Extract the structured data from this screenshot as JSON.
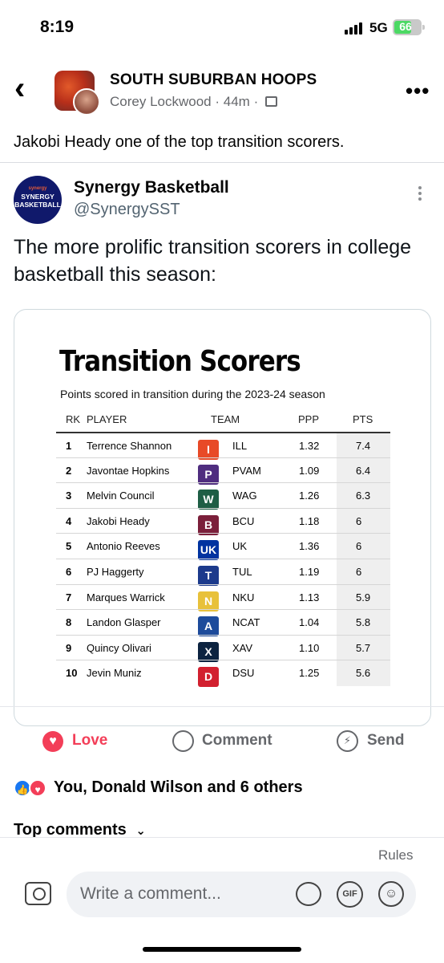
{
  "status_bar": {
    "time": "8:19",
    "network": "5G",
    "battery": "66",
    "battery_level": 0.66
  },
  "post": {
    "group_name": "SOUTH SUBURBAN HOOPS",
    "author": "Corey Lockwood",
    "separator": "·",
    "time_ago": "44m",
    "text": "Jakobi Heady one of the top transition scorers."
  },
  "tweet": {
    "avatar_small": "synergy",
    "avatar_big": "SYNERGY BASKETBALL",
    "name": "Synergy Basketball",
    "handle": "@SynergySST",
    "text": "The more prolific transition scorers in college basketball this season:"
  },
  "table": {
    "title": "Transition Scorers",
    "subtitle": "Points scored in transition during the 2023-24 season",
    "headers": {
      "rk": "RK",
      "player": "PLAYER",
      "team": "TEAM",
      "ppp": "PPP",
      "pts": "PTS"
    },
    "rows": [
      {
        "rk": "1",
        "player": "Terrence Shannon",
        "team": "ILL",
        "ppp": "1.32",
        "pts": "7.4",
        "logo": "I",
        "color": "#e84a27"
      },
      {
        "rk": "2",
        "player": "Javontae Hopkins",
        "team": "PVAM",
        "ppp": "1.09",
        "pts": "6.4",
        "logo": "P",
        "color": "#4f2d7f"
      },
      {
        "rk": "3",
        "player": "Melvin Council",
        "team": "WAG",
        "ppp": "1.26",
        "pts": "6.3",
        "logo": "W",
        "color": "#1e5e45"
      },
      {
        "rk": "4",
        "player": "Jakobi Heady",
        "team": "BCU",
        "ppp": "1.18",
        "pts": "6",
        "logo": "B",
        "color": "#7b1f3a"
      },
      {
        "rk": "5",
        "player": "Antonio Reeves",
        "team": "UK",
        "ppp": "1.36",
        "pts": "6",
        "logo": "UK",
        "color": "#0033a0"
      },
      {
        "rk": "6",
        "player": "PJ Haggerty",
        "team": "TUL",
        "ppp": "1.19",
        "pts": "6",
        "logo": "T",
        "color": "#1c3a8c"
      },
      {
        "rk": "7",
        "player": "Marques Warrick",
        "team": "NKU",
        "ppp": "1.13",
        "pts": "5.9",
        "logo": "N",
        "color": "#e8c13a"
      },
      {
        "rk": "8",
        "player": "Landon Glasper",
        "team": "NCAT",
        "ppp": "1.04",
        "pts": "5.8",
        "logo": "A",
        "color": "#1d4b9b"
      },
      {
        "rk": "9",
        "player": "Quincy Olivari",
        "team": "XAV",
        "ppp": "1.10",
        "pts": "5.7",
        "logo": "X",
        "color": "#0c2340"
      },
      {
        "rk": "10",
        "player": "Jevin Muniz",
        "team": "DSU",
        "ppp": "1.25",
        "pts": "5.6",
        "logo": "D",
        "color": "#d2202f"
      }
    ]
  },
  "actions": {
    "love": "Love",
    "comment": "Comment",
    "send": "Send"
  },
  "reactions_text": "You, Donald Wilson and 6 others",
  "top_comments_label": "Top comments",
  "rules_label": "Rules",
  "comment_placeholder": "Write a comment...",
  "gif_label": "GIF",
  "colors": {
    "love": "#f33e58",
    "like": "#1877f2",
    "muted": "#65676b"
  }
}
